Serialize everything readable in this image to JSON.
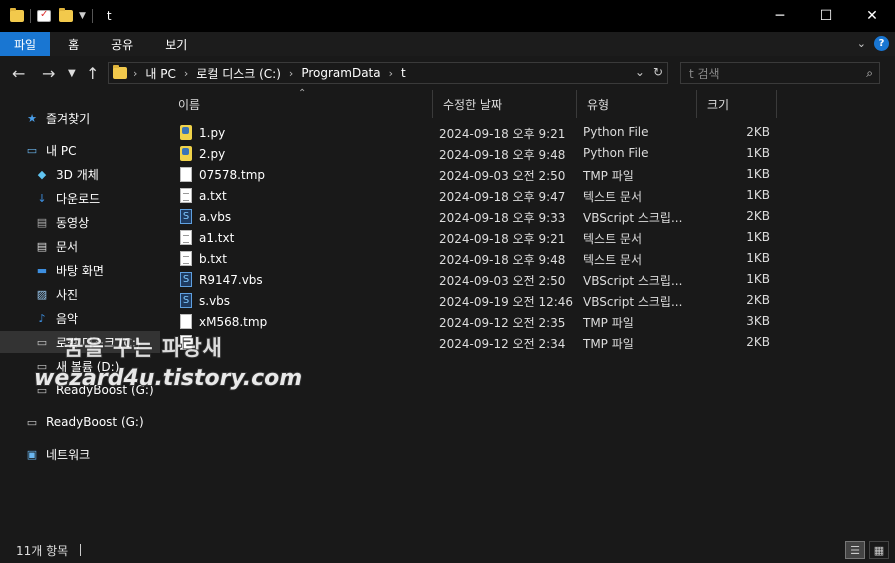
{
  "window": {
    "title": "t",
    "controls": {
      "minimize": "─",
      "maximize": "☐",
      "close": "✕"
    }
  },
  "ribbon": {
    "tabs": [
      {
        "label": "파일",
        "active": true
      },
      {
        "label": "홈",
        "active": false
      },
      {
        "label": "공유",
        "active": false
      },
      {
        "label": "보기",
        "active": false
      }
    ],
    "help": "?"
  },
  "address": {
    "crumbs": [
      "내 PC",
      "로컬 디스크 (C:)",
      "ProgramData",
      "t"
    ],
    "search_placeholder": "t 검색"
  },
  "nav": {
    "items": [
      {
        "label": "즐겨찾기",
        "icon": "star-icon",
        "glyph": "★",
        "color": "#4a9ee8"
      },
      {
        "label": "내 PC",
        "icon": "computer-icon",
        "glyph": "▭",
        "color": "#6bb7f0"
      },
      {
        "label": "3D 개체",
        "icon": "cube-icon",
        "glyph": "◆",
        "color": "#5fc3f0"
      },
      {
        "label": "다운로드",
        "icon": "download-icon",
        "glyph": "↓",
        "color": "#3d8fe0"
      },
      {
        "label": "동영상",
        "icon": "video-icon",
        "glyph": "▤",
        "color": "#aaaaaa"
      },
      {
        "label": "문서",
        "icon": "document-icon",
        "glyph": "▤",
        "color": "#dddddd"
      },
      {
        "label": "바탕 화면",
        "icon": "desktop-icon",
        "glyph": "▬",
        "color": "#3d8fe0"
      },
      {
        "label": "사진",
        "icon": "picture-icon",
        "glyph": "▨",
        "color": "#9ac9f0"
      },
      {
        "label": "음악",
        "icon": "music-icon",
        "glyph": "♪",
        "color": "#3d8fe0"
      },
      {
        "label": "로컬 디스크 (C:)",
        "icon": "drive-icon",
        "glyph": "▭",
        "color": "#cccccc"
      },
      {
        "label": "새 볼륨 (D:)",
        "icon": "drive-icon",
        "glyph": "▭",
        "color": "#cccccc"
      },
      {
        "label": "ReadyBoost (G:)",
        "icon": "drive-icon",
        "glyph": "▭",
        "color": "#cccccc"
      },
      {
        "label": "ReadyBoost (G:)",
        "icon": "drive-icon",
        "glyph": "▭",
        "color": "#cccccc"
      },
      {
        "label": "네트워크",
        "icon": "network-icon",
        "glyph": "▣",
        "color": "#6bb7f0"
      }
    ]
  },
  "columns": {
    "name": "이름",
    "date": "수정한 날짜",
    "type": "유형",
    "size": "크기"
  },
  "files": [
    {
      "name": "1.py",
      "icon": "python-file-icon",
      "date": "2024-09-18 오후 9:21",
      "type": "Python File",
      "size": "2KB"
    },
    {
      "name": "2.py",
      "icon": "python-file-icon",
      "date": "2024-09-18 오후 9:48",
      "type": "Python File",
      "size": "1KB"
    },
    {
      "name": "07578.tmp",
      "icon": "tmp-file-icon",
      "date": "2024-09-03 오전 2:50",
      "type": "TMP 파일",
      "size": "1KB"
    },
    {
      "name": "a.txt",
      "icon": "text-file-icon",
      "date": "2024-09-18 오후 9:47",
      "type": "텍스트 문서",
      "size": "1KB"
    },
    {
      "name": "a.vbs",
      "icon": "vbs-file-icon",
      "date": "2024-09-18 오후 9:33",
      "type": "VBScript 스크립...",
      "size": "2KB"
    },
    {
      "name": "a1.txt",
      "icon": "text-file-icon",
      "date": "2024-09-18 오후 9:21",
      "type": "텍스트 문서",
      "size": "1KB"
    },
    {
      "name": "b.txt",
      "icon": "text-file-icon",
      "date": "2024-09-18 오후 9:48",
      "type": "텍스트 문서",
      "size": "1KB"
    },
    {
      "name": "R9147.vbs",
      "icon": "vbs-file-icon",
      "date": "2024-09-03 오전 2:50",
      "type": "VBScript 스크립...",
      "size": "1KB"
    },
    {
      "name": "s.vbs",
      "icon": "vbs-file-icon",
      "date": "2024-09-19 오전 12:46",
      "type": "VBScript 스크립...",
      "size": "2KB"
    },
    {
      "name": "xM568.tmp",
      "icon": "tmp-file-icon",
      "date": "2024-09-12 오전 2:35",
      "type": "TMP 파일",
      "size": "3KB"
    },
    {
      "name": "",
      "icon": "tmp-file-icon",
      "date": "2024-09-12 오전 2:34",
      "type": "TMP 파일",
      "size": "2KB"
    }
  ],
  "watermark": {
    "line1": "꿈을 꾸는 파랑새",
    "line2": "wezard4u.tistory.com"
  },
  "status": {
    "count": "11개 항목"
  }
}
